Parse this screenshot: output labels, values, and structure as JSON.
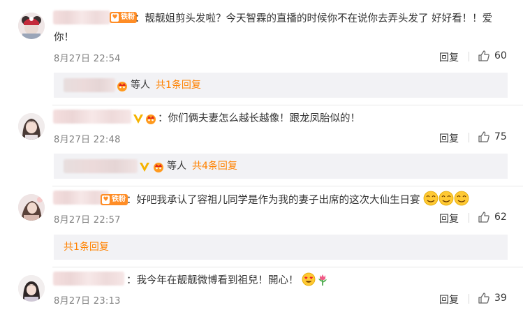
{
  "comments": [
    {
      "badge": "铁粉",
      "text_line1": "：靓靓姐剪头发啦？今天智霖的直播的时候你不在说你去弄头发了 好好看！！爱",
      "text_line2": "你！",
      "time": "8月27日 22:54",
      "reply_label": "回复",
      "likes": "60",
      "thread": {
        "others_label": "等人",
        "link_label": "共1条回复"
      }
    },
    {
      "text": "：你们俩夫妻怎么越长越像！跟龙凤胎似的！",
      "time": "8月27日 22:48",
      "reply_label": "回复",
      "likes": "75",
      "thread": {
        "others_label": "等人",
        "link_label": "共4条回复"
      }
    },
    {
      "badge": "铁粉",
      "text": "：好吧我承认了容祖儿同学是作为我的妻子出席的这次大仙生日宴",
      "time": "8月27日 22:57",
      "reply_label": "回复",
      "likes": "62",
      "thread": {
        "link_label": "共1条回复"
      }
    },
    {
      "text": "：我今年在靓靓微博看到祖兒！開心！",
      "time": "8月27日 23:13",
      "reply_label": "回复",
      "likes": "39"
    }
  ],
  "colors": {
    "link": "#ff8200",
    "badge": "#ff8d26",
    "subbox": "#f2f2f5"
  }
}
